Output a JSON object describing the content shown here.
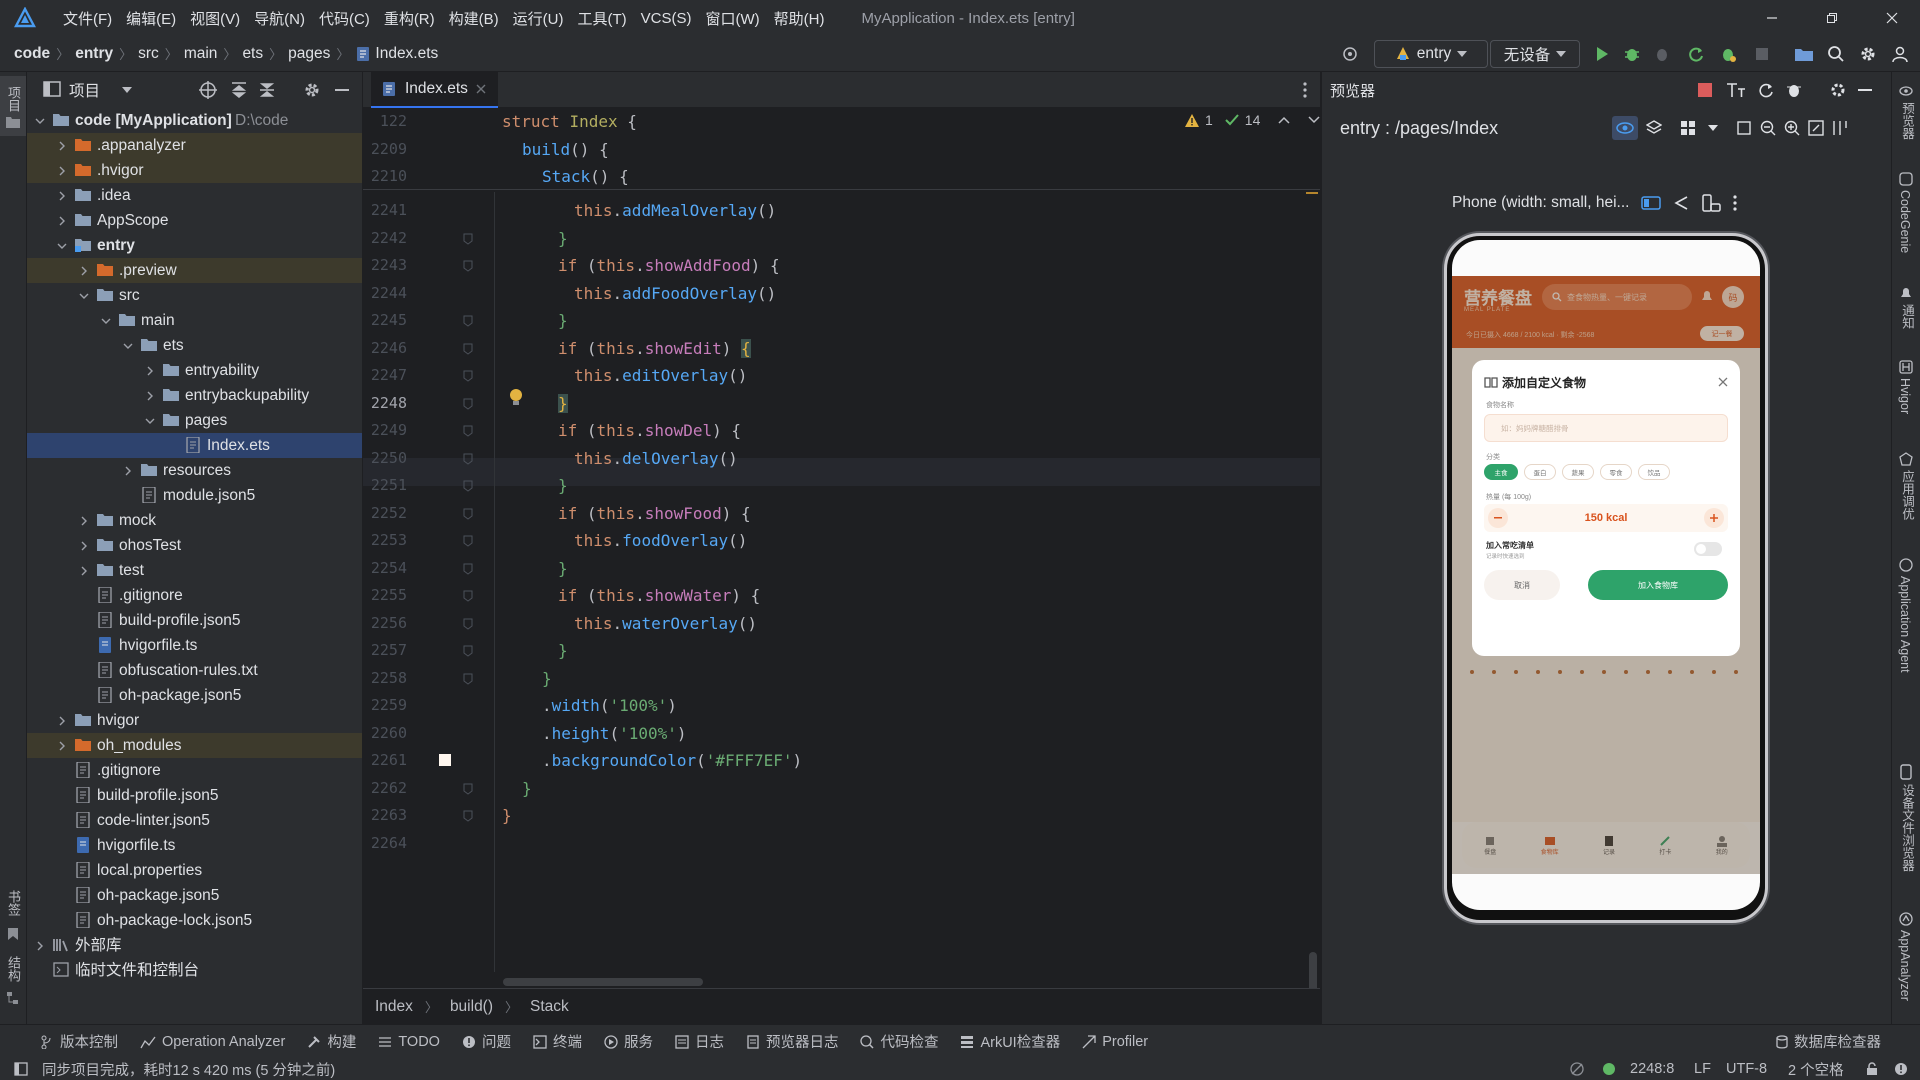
{
  "app": {
    "window_title": "MyApplication - Index.ets [entry]"
  },
  "menu": [
    "文件(F)",
    "编辑(E)",
    "视图(V)",
    "导航(N)",
    "代码(C)",
    "重构(R)",
    "构建(B)",
    "运行(U)",
    "工具(T)",
    "VCS(S)",
    "窗口(W)",
    "帮助(H)"
  ],
  "breadcrumb": [
    "code",
    "entry",
    "src",
    "main",
    "ets",
    "pages",
    "Index.ets"
  ],
  "toolbar": {
    "module": "entry",
    "device": "无设备"
  },
  "left_strip": {
    "project": "项目",
    "bookmarks": "书签",
    "structure": "结构"
  },
  "project": {
    "title": "项目",
    "tree": [
      {
        "label": "code [MyApplication]",
        "sub": "D:\\code"
      },
      {
        "label": ".appanalyzer"
      },
      {
        "label": ".hvigor"
      },
      {
        "label": ".idea"
      },
      {
        "label": "AppScope"
      },
      {
        "label": "entry"
      },
      {
        "label": ".preview"
      },
      {
        "label": "src"
      },
      {
        "label": "main"
      },
      {
        "label": "ets"
      },
      {
        "label": "entryability"
      },
      {
        "label": "entrybackupability"
      },
      {
        "label": "pages"
      },
      {
        "label": "Index.ets"
      },
      {
        "label": "resources"
      },
      {
        "label": "module.json5"
      },
      {
        "label": "mock"
      },
      {
        "label": "ohosTest"
      },
      {
        "label": "test"
      },
      {
        "label": ".gitignore"
      },
      {
        "label": "build-profile.json5"
      },
      {
        "label": "hvigorfile.ts"
      },
      {
        "label": "obfuscation-rules.txt"
      },
      {
        "label": "oh-package.json5"
      },
      {
        "label": "hvigor"
      },
      {
        "label": "oh_modules"
      },
      {
        "label": ".gitignore"
      },
      {
        "label": "build-profile.json5"
      },
      {
        "label": "code-linter.json5"
      },
      {
        "label": "hvigorfile.ts"
      },
      {
        "label": "local.properties"
      },
      {
        "label": "oh-package.json5"
      },
      {
        "label": "oh-package-lock.json5"
      },
      {
        "label": "外部库"
      },
      {
        "label": "临时文件和控制台"
      }
    ]
  },
  "editor": {
    "tab": "Index.ets",
    "inspections": {
      "warnings": "1",
      "checks": "14"
    },
    "sticky_lines": [
      "122",
      "2209",
      "2210"
    ],
    "lines": [
      "2241",
      "2242",
      "2243",
      "2244",
      "2245",
      "2246",
      "2247",
      "2248",
      "2249",
      "2250",
      "2251",
      "2252",
      "2253",
      "2254",
      "2255",
      "2256",
      "2257",
      "2258",
      "2259",
      "2260",
      "2261",
      "2262",
      "2263",
      "2264"
    ],
    "code": {
      "struct": "struct",
      "index": "Index",
      "build": "build",
      "stack": "Stack",
      "this": "this",
      "if": "if",
      "addMealOverlay": "addMealOverlay",
      "showAddFood": "showAddFood",
      "addFoodOverlay": "addFoodOverlay",
      "showEdit": "showEdit",
      "editOverlay": "editOverlay",
      "showDel": "showDel",
      "delOverlay": "delOverlay",
      "showFood": "showFood",
      "foodOverlay": "foodOverlay",
      "showWater": "showWater",
      "waterOverlay": "waterOverlay",
      "width": "width",
      "height": "height",
      "backgroundColor": "backgroundColor",
      "pct": "'100%'",
      "color": "'#FFF7EF'"
    },
    "breadcrumb": [
      "Index",
      "build()",
      "Stack"
    ]
  },
  "previewer": {
    "title": "预览器",
    "route": "entry : /pages/Index",
    "device": "Phone (width: small, hei...",
    "app": {
      "brand": "营养餐盘",
      "brand_en": "MEAL PLATE",
      "search": "查食物热量、一键记录",
      "avatar": "码",
      "summary": "今日已摄入 4668 / 2100 kcal · 剩余 -2568",
      "record_btn": "记一餐",
      "dialog": {
        "title": "添加自定义食物",
        "name_label": "食物名称",
        "name_placeholder": "如：妈妈牌糖醋排骨",
        "category_label": "分类",
        "categories": [
          "主食",
          "蛋白",
          "蔬果",
          "零食",
          "饮品"
        ],
        "kcal_label": "热量 (每 100g)",
        "kcal_value": "150 kcal",
        "fav_label": "加入常吃清单",
        "fav_sub": "记录时快速选到",
        "cancel": "取消",
        "confirm": "加入食物库"
      },
      "nav": [
        "餐盘",
        "食物库",
        "记录",
        "打卡",
        "我的"
      ]
    }
  },
  "right_strip": [
    "预览器",
    "CodeGenie",
    "通知",
    "Hvigor",
    "应用调优",
    "Application Agent",
    "设备文件浏览器",
    "AppAnalyzer"
  ],
  "tool_windows": [
    "版本控制",
    "Operation Analyzer",
    "构建",
    "TODO",
    "问题",
    "终端",
    "服务",
    "日志",
    "预览器日志",
    "代码检查",
    "ArkUI检查器",
    "Profiler"
  ],
  "db_inspector": "数据库检查器",
  "status": {
    "message": "同步项目完成，耗时12 s 420 ms (5 分钟之前)",
    "position": "2248:8",
    "line_sep": "LF",
    "encoding": "UTF-8",
    "indent": "2 个空格"
  },
  "colors": {
    "accent": "#3574f0",
    "app_orange": "#d9531e",
    "app_green": "#2ea36a"
  }
}
